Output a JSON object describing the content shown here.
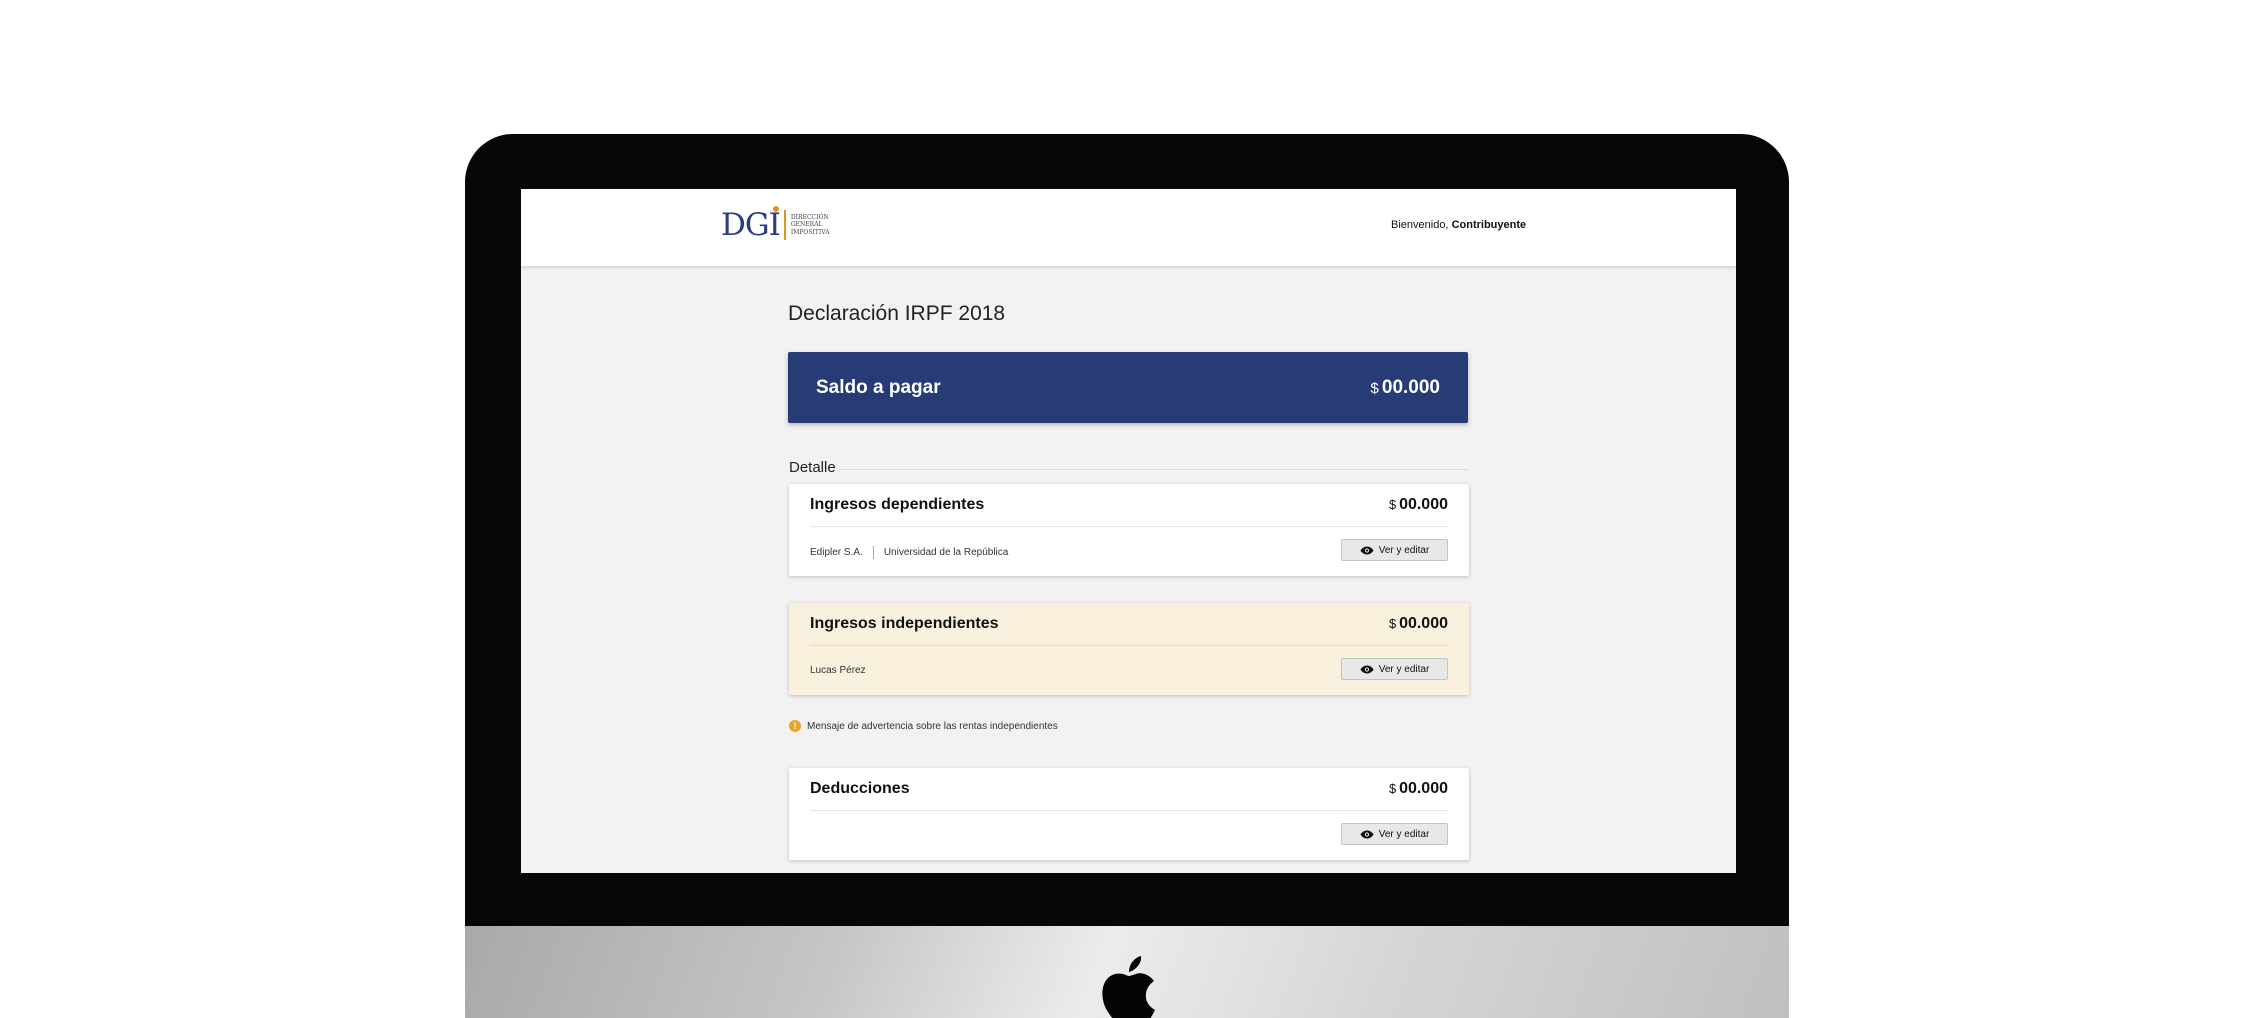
{
  "header": {
    "logo_mark": "DGI",
    "logo_lines": [
      "Dirección",
      "General",
      "Impositiva"
    ],
    "welcome_prefix": "Bienvenido,",
    "welcome_user": "Contribuyente"
  },
  "page_title": "Declaración IRPF 2018",
  "saldo": {
    "label": "Saldo a pagar",
    "currency": "$",
    "amount": "00.000"
  },
  "detalle_label": "Detalle",
  "cards": [
    {
      "title": "Ingresos dependientes",
      "currency": "$",
      "amount": "00.000",
      "subitems": [
        "Edipler S.A.",
        "Universidad de la República"
      ],
      "button": "Ver y editar"
    },
    {
      "title": "Ingresos independientes",
      "currency": "$",
      "amount": "00.000",
      "subitems": [
        "Lucas Pérez"
      ],
      "button": "Ver y editar"
    },
    {
      "title": "Deducciones",
      "currency": "$",
      "amount": "00.000",
      "subitems": [],
      "button": "Ver y editar"
    }
  ],
  "warning": {
    "icon": "!",
    "text": "Mensaje de advertencia sobre las rentas independientes"
  },
  "icons": {
    "button_icon": "eye-icon",
    "warning_icon": "warning-icon",
    "device_logo": "apple-logo-icon"
  },
  "colors": {
    "primary": "#273c77",
    "warning_bg": "#f9f1de",
    "warning_accent": "#e7a528",
    "logo_accent": "#e0931e"
  }
}
